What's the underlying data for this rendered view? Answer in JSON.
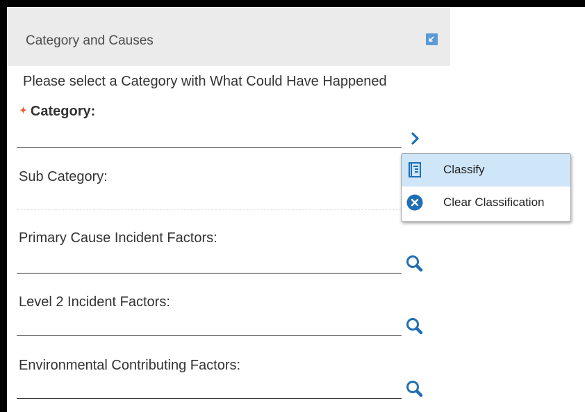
{
  "panel": {
    "title": "Category and Causes",
    "instruction": "Please select a Category with What Could Have Happened"
  },
  "fields": {
    "category_label": "Category:",
    "required_marker": "✦",
    "sub_category_label": "Sub Category:",
    "primary_cause_label": "Primary Cause Incident Factors:",
    "level2_label": "Level 2 Incident Factors:",
    "environmental_label": "Environmental Contributing Factors:"
  },
  "menu": {
    "classify_label": "Classify",
    "clear_label": "Clear Classification"
  },
  "icons": {
    "collapse": "collapse-arrow-icon",
    "chevron": "chevron-right-icon",
    "search": "magnifier-icon",
    "classify": "list-document-icon",
    "clear": "close-circle-icon"
  },
  "colors": {
    "accent": "#1f6fb5",
    "header_bg": "#ebebeb",
    "menu_highlight": "#cfe5f8",
    "required": "#e8612c"
  }
}
